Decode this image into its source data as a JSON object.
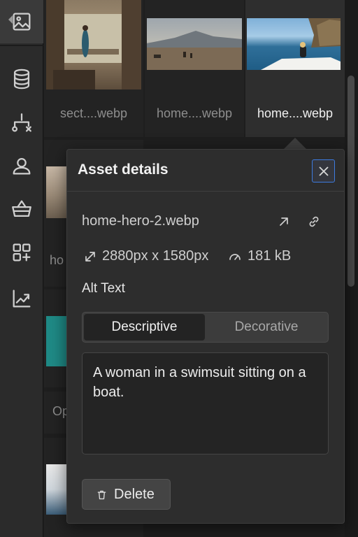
{
  "rail": {
    "items": [
      {
        "icon": "image-icon",
        "active": true
      },
      {
        "icon": "database-icon"
      },
      {
        "icon": "logic-flow-icon"
      },
      {
        "icon": "user-icon"
      },
      {
        "icon": "basket-icon"
      },
      {
        "icon": "apps-add-icon"
      },
      {
        "icon": "analytics-icon"
      }
    ]
  },
  "assets": {
    "tiles": [
      {
        "label": "sect....webp"
      },
      {
        "label": "home....webp"
      },
      {
        "label": "home....webp",
        "selected": true
      },
      {
        "label": "ho"
      },
      {
        "label": "Op"
      }
    ]
  },
  "asset_details": {
    "title": "Asset details",
    "file_name": "home-hero-2.webp",
    "dimensions": "2880px x 1580px",
    "file_size": "181 kB",
    "alt_text_label": "Alt Text",
    "alt_mode_options": [
      "Descriptive",
      "Decorative"
    ],
    "alt_mode_selected": "Descriptive",
    "alt_text_value": "A woman in a swimsuit sitting on a boat.",
    "delete_label": "Delete"
  },
  "colors": {
    "accent": "#3d7be0",
    "panel": "#2d2d2d",
    "rail": "#2b2b2b"
  }
}
